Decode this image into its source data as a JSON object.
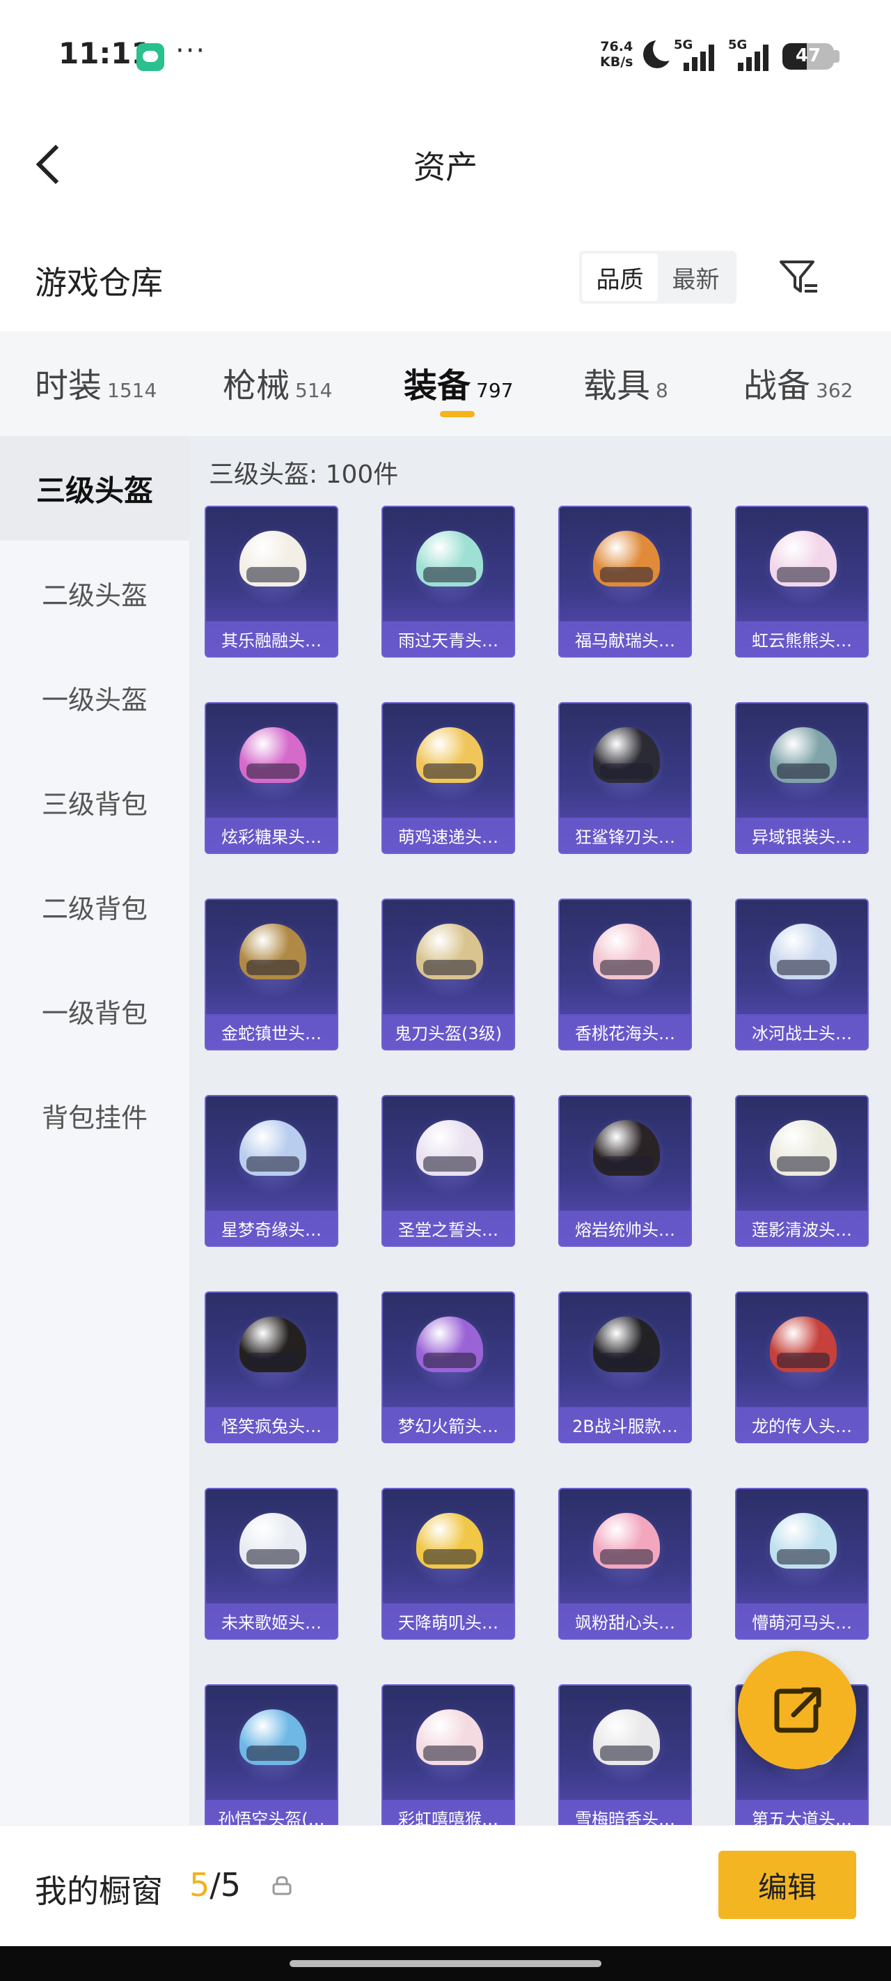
{
  "status_bar": {
    "time": "11:11",
    "net_speed_value": "76.4",
    "net_speed_unit": "KB/s",
    "signal1_label": "5G",
    "signal2_label": "5G",
    "battery": "47",
    "battery_level": 0.47
  },
  "header": {
    "title": "资产",
    "back_icon": "chevron-left-icon"
  },
  "warehouse": {
    "title": "游戏仓库",
    "sort_options": [
      "品质",
      "最新"
    ],
    "sort_selected": "品质",
    "filter_icon": "filter-icon"
  },
  "tabs": [
    {
      "label": "时装",
      "count": "1514"
    },
    {
      "label": "枪械",
      "count": "514"
    },
    {
      "label": "装备",
      "count": "797",
      "active": true
    },
    {
      "label": "载具",
      "count": "8"
    },
    {
      "label": "战备",
      "count": "362"
    }
  ],
  "sidebar": [
    {
      "label": "三级头盔",
      "active": true
    },
    {
      "label": "二级头盔"
    },
    {
      "label": "一级头盔"
    },
    {
      "label": "三级背包"
    },
    {
      "label": "二级背包"
    },
    {
      "label": "一级背包"
    },
    {
      "label": "背包挂件"
    }
  ],
  "content": {
    "count_label": "三级头盔: 100件",
    "items": [
      {
        "name": "其乐融融头…",
        "color": "#f3efe6"
      },
      {
        "name": "雨过天青头…",
        "color": "#9fe0d4"
      },
      {
        "name": "福马献瑞头…",
        "color": "#e08a3a"
      },
      {
        "name": "虹云熊熊头…",
        "color": "#f2d7ea"
      },
      {
        "name": "炫彩糖果头…",
        "color": "#d66acb"
      },
      {
        "name": "萌鸡速递头…",
        "color": "#f0c65a"
      },
      {
        "name": "狂鲨锋刃头…",
        "color": "#2b2b33"
      },
      {
        "name": "异域银装头…",
        "color": "#7fa3a8"
      },
      {
        "name": "金蛇镇世头…",
        "color": "#b08a45"
      },
      {
        "name": "鬼刀头盔(3级)",
        "color": "#d9c48f"
      },
      {
        "name": "香桃花海头…",
        "color": "#f3c4cf"
      },
      {
        "name": "冰河战士头…",
        "color": "#c9d8ee"
      },
      {
        "name": "星梦奇缘头…",
        "color": "#b9cdee"
      },
      {
        "name": "圣堂之誓头…",
        "color": "#e9e1f0"
      },
      {
        "name": "熔岩统帅头…",
        "color": "#2a2326"
      },
      {
        "name": "莲影清波头…",
        "color": "#ecebdf"
      },
      {
        "name": "怪笑疯兔头…",
        "color": "#24201f"
      },
      {
        "name": "梦幻火箭头…",
        "color": "#9a63d6"
      },
      {
        "name": "2B战斗服款…",
        "color": "#222226"
      },
      {
        "name": "龙的传人头…",
        "color": "#c6413b"
      },
      {
        "name": "未来歌姬头…",
        "color": "#e8ecf2"
      },
      {
        "name": "天降萌叽头…",
        "color": "#f0c746"
      },
      {
        "name": "飒粉甜心头…",
        "color": "#f2a7bf"
      },
      {
        "name": "懵萌河马头…",
        "color": "#bfe0ee"
      },
      {
        "name": "孙悟空头盔(…",
        "color": "#6fb8e6"
      },
      {
        "name": "彩虹嘻嘻猴…",
        "color": "#f4dbe2"
      },
      {
        "name": "雪梅暗香头…",
        "color": "#e9e8ea"
      },
      {
        "name": "第五大道头…",
        "color": "#d7dde6"
      }
    ]
  },
  "fab": {
    "icon": "share-icon"
  },
  "bottom_bar": {
    "label": "我的橱窗",
    "count_used": "5",
    "count_sep": "/",
    "count_total": "5",
    "lock_icon": "lock-icon",
    "edit_label": "编辑"
  },
  "colors": {
    "accent": "#f3b622",
    "card_bg": "#3a3a86"
  }
}
